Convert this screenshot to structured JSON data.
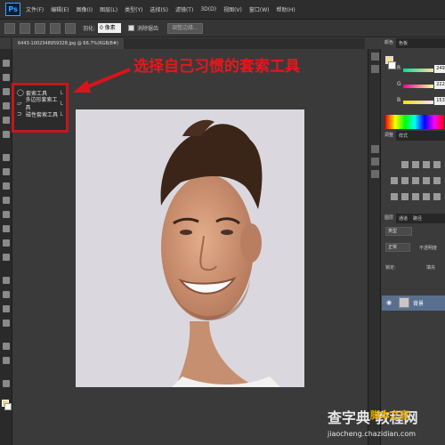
{
  "app": {
    "logo": "Ps",
    "menu": [
      "文件(F)",
      "编辑(E)",
      "图像(I)",
      "图层(L)",
      "类型(Y)",
      "选择(S)",
      "滤镜(T)",
      "3D(D)",
      "视图(V)",
      "窗口(W)",
      "帮助(H)"
    ]
  },
  "options_bar": {
    "feather_label": "羽化:",
    "feather_value": "0 像素",
    "antialias_label": "消除锯齿",
    "refine_edge_label": "调整边缘..."
  },
  "document": {
    "tab_title": "6443-1002348959328.jpg @ 66.7%(RGB/8#)"
  },
  "annotation": {
    "text": "选择自己习惯的套索工具",
    "color": "#e8161c"
  },
  "lasso_flyout": {
    "items": [
      {
        "label": "套索工具",
        "key": "L",
        "icon": "lasso-icon",
        "selected": false
      },
      {
        "label": "多边形套索工具",
        "key": "L",
        "icon": "polygonal-lasso-icon",
        "selected": true
      },
      {
        "label": "磁性套索工具",
        "key": "L",
        "icon": "magnetic-lasso-icon",
        "selected": false
      }
    ]
  },
  "color_panel": {
    "tabs": [
      "颜色",
      "色板"
    ],
    "sliders": [
      {
        "channel": "R",
        "value": "249"
      },
      {
        "channel": "G",
        "value": "222"
      },
      {
        "channel": "B",
        "value": "153"
      }
    ],
    "foreground_color": "#f9de99"
  },
  "adjustments_panel": {
    "tabs": [
      "调整",
      "样式"
    ]
  },
  "layers_panel": {
    "tabs": [
      "图层",
      "通道",
      "路径"
    ],
    "kind_label": "类型",
    "blend_mode": "正常",
    "opacity_label": "不透明度",
    "lock_label": "锁定:",
    "fill_label": "填充",
    "layer_name": "背景"
  },
  "watermarks": {
    "big": "查字典 教程网",
    "site": "脚本之家",
    "url": "jiaocheng.chazidian.com"
  }
}
